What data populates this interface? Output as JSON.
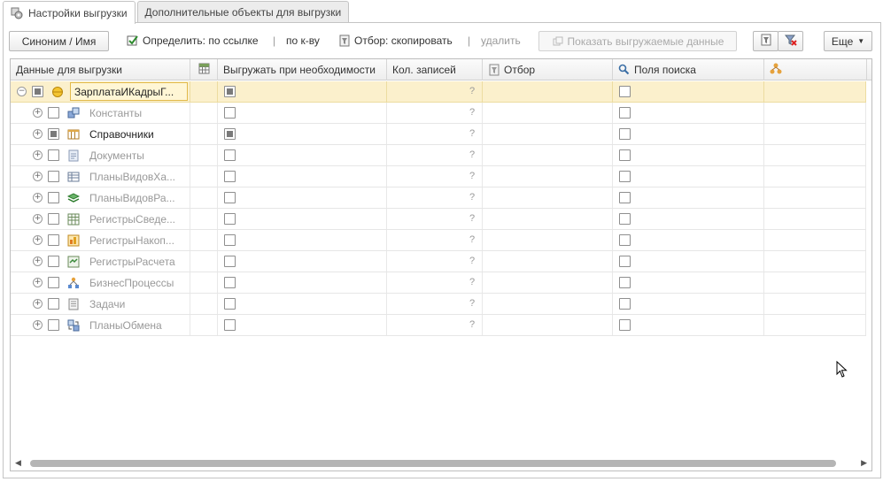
{
  "tabs": [
    {
      "label": "Настройки выгрузки",
      "active": true
    },
    {
      "label": "Дополнительные объекты для выгрузки",
      "active": false
    }
  ],
  "toolbar": {
    "synonym_button": "Синоним / Имя",
    "define_by_ref": "Определить: по ссылке",
    "separator": "|",
    "by_count": "по к-ву",
    "filter_copy": "Отбор: скопировать",
    "delete": "удалить",
    "show_data_button": "Показать выгружаемые данные",
    "more_button": "Еще"
  },
  "columns": {
    "data": "Данные для выгрузки",
    "export_if_needed": "Выгружать при необходимости",
    "records_count": "Кол. записей",
    "filter": "Отбор",
    "search_fields": "Поля поиска"
  },
  "rows": [
    {
      "label": "ЗарплатаИКадрыГ...",
      "level": 0,
      "expanded": true,
      "check": "partial",
      "export": "partial",
      "count": "?",
      "search": false,
      "active": true,
      "icon": "config-icon"
    },
    {
      "label": "Константы",
      "level": 1,
      "check": "none",
      "export": "none",
      "count": "?",
      "search": false,
      "active": false,
      "icon": "constants-icon"
    },
    {
      "label": "Справочники",
      "level": 1,
      "check": "partial",
      "export": "partial",
      "count": "?",
      "search": false,
      "active": true,
      "icon": "catalogs-icon"
    },
    {
      "label": "Документы",
      "level": 1,
      "check": "none",
      "export": "none",
      "count": "?",
      "search": false,
      "active": false,
      "icon": "documents-icon"
    },
    {
      "label": "ПланыВидовХа...",
      "level": 1,
      "check": "none",
      "export": "none",
      "count": "?",
      "search": false,
      "active": false,
      "icon": "chart-of-characteristics-icon"
    },
    {
      "label": "ПланыВидовРа...",
      "level": 1,
      "check": "none",
      "export": "none",
      "count": "?",
      "search": false,
      "active": false,
      "icon": "chart-of-calculation-icon"
    },
    {
      "label": "РегистрыСведе...",
      "level": 1,
      "check": "none",
      "export": "none",
      "count": "?",
      "search": false,
      "active": false,
      "icon": "info-registers-icon"
    },
    {
      "label": "РегистрыНакоп...",
      "level": 1,
      "check": "none",
      "export": "none",
      "count": "?",
      "search": false,
      "active": false,
      "icon": "accumulation-registers-icon"
    },
    {
      "label": "РегистрыРасчета",
      "level": 1,
      "check": "none",
      "export": "none",
      "count": "?",
      "search": false,
      "active": false,
      "icon": "calculation-registers-icon"
    },
    {
      "label": "БизнесПроцессы",
      "level": 1,
      "check": "none",
      "export": "none",
      "count": "?",
      "search": false,
      "active": false,
      "icon": "business-processes-icon"
    },
    {
      "label": "Задачи",
      "level": 1,
      "check": "none",
      "export": "none",
      "count": "?",
      "search": false,
      "active": false,
      "icon": "tasks-icon"
    },
    {
      "label": "ПланыОбмена",
      "level": 1,
      "check": "none",
      "export": "none",
      "count": "?",
      "search": false,
      "active": false,
      "icon": "exchange-plans-icon"
    }
  ]
}
